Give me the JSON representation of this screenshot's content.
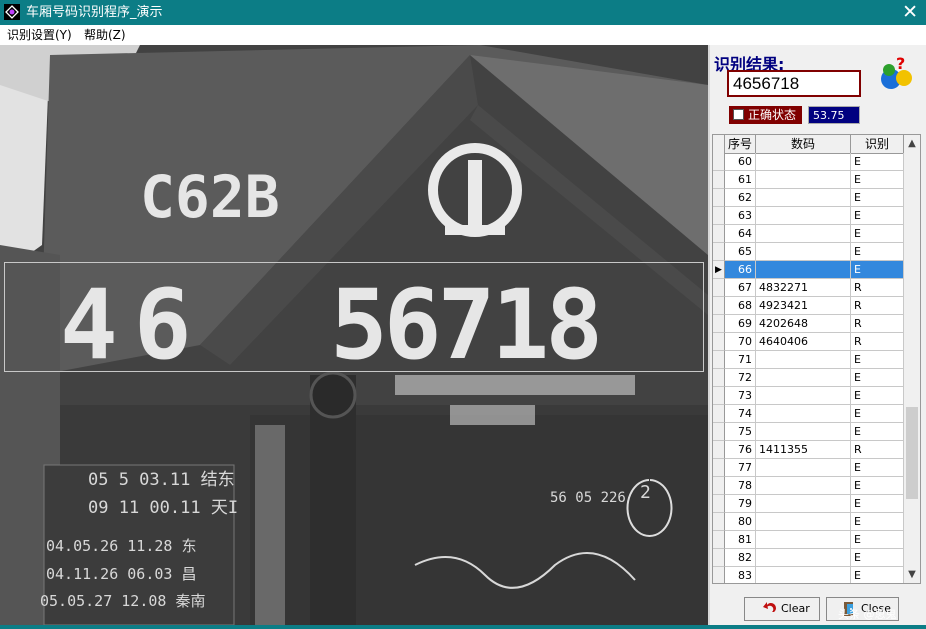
{
  "window": {
    "title": "车厢号码识别程序_演示",
    "close_symbol": "✕"
  },
  "menu": [
    {
      "label": "识别设置(Y)"
    },
    {
      "label": "帮助(Z)"
    }
  ],
  "image_text": {
    "model": "C62B",
    "left_digits": "46",
    "right_digits": "56718",
    "chalk_lines": [
      "05  5 03.11 结东",
      "09 11 00.11 天I",
      "04.05.26 11.28  东",
      "04.11.26 06.03  昌",
      "05.05.27 12.08  秦南",
      "56 05 226",
      "2"
    ]
  },
  "result": {
    "label": "识别结果:",
    "value": "4656718",
    "status_label": "正确状态",
    "score": "53.75"
  },
  "grid": {
    "columns": [
      "序号",
      "数码",
      "识别"
    ],
    "selected_row": 6,
    "rows": [
      {
        "no": "60",
        "code": "",
        "flag": "E"
      },
      {
        "no": "61",
        "code": "",
        "flag": "E"
      },
      {
        "no": "62",
        "code": "",
        "flag": "E"
      },
      {
        "no": "63",
        "code": "",
        "flag": "E"
      },
      {
        "no": "64",
        "code": "",
        "flag": "E"
      },
      {
        "no": "65",
        "code": "",
        "flag": "E"
      },
      {
        "no": "66",
        "code": "",
        "flag": "E"
      },
      {
        "no": "67",
        "code": "4832271",
        "flag": "R"
      },
      {
        "no": "68",
        "code": "4923421",
        "flag": "R"
      },
      {
        "no": "69",
        "code": "4202648",
        "flag": "R"
      },
      {
        "no": "70",
        "code": "4640406",
        "flag": "R"
      },
      {
        "no": "71",
        "code": "",
        "flag": "E"
      },
      {
        "no": "72",
        "code": "",
        "flag": "E"
      },
      {
        "no": "73",
        "code": "",
        "flag": "E"
      },
      {
        "no": "74",
        "code": "",
        "flag": "E"
      },
      {
        "no": "75",
        "code": "",
        "flag": "E"
      },
      {
        "no": "76",
        "code": "1411355",
        "flag": "R"
      },
      {
        "no": "77",
        "code": "",
        "flag": "E"
      },
      {
        "no": "78",
        "code": "",
        "flag": "E"
      },
      {
        "no": "79",
        "code": "",
        "flag": "E"
      },
      {
        "no": "80",
        "code": "",
        "flag": "E"
      },
      {
        "no": "81",
        "code": "",
        "flag": "E"
      },
      {
        "no": "82",
        "code": "",
        "flag": "E"
      },
      {
        "no": "83",
        "code": "",
        "flag": "E"
      }
    ]
  },
  "buttons": {
    "clear": "Clear",
    "close": "Close"
  },
  "watermark": "头条 @思鬼",
  "colors": {
    "titlebar": "#0c7d86",
    "result_label": "#000080",
    "result_border": "#800000",
    "status_bg": "#800000",
    "score_bg": "#000080",
    "selection": "#3388dd"
  },
  "icons": {
    "app": "app-icon",
    "help": "help-question-icon",
    "clear": "undo-arrow-icon",
    "close": "exit-door-icon",
    "close_window": "close-icon"
  }
}
